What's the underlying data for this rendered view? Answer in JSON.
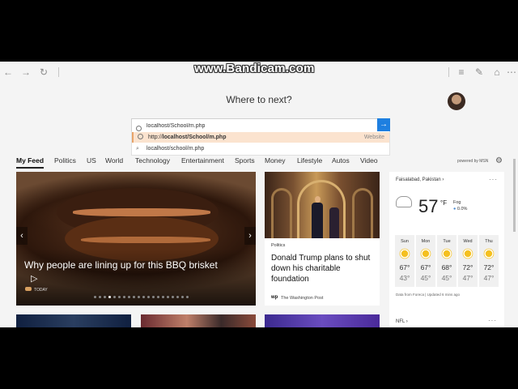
{
  "watermark": "www.Bandicam.com",
  "toolbar": {
    "back": "←",
    "forward": "→",
    "refresh": "↻"
  },
  "newtab": {
    "heading": "Where to next?"
  },
  "address": {
    "value": "localhost/School/m.php",
    "go": "→",
    "suggestions": [
      {
        "prefix": "http://",
        "bold": "localhost/School/m.php",
        "tag": "Website",
        "selected": true
      },
      {
        "text": "localhost/school/m.php",
        "selected": false
      }
    ]
  },
  "nav": {
    "items": [
      "My Feed",
      "Politics",
      "US",
      "World",
      "Technology",
      "Entertainment",
      "Sports",
      "Money",
      "Lifestyle",
      "Autos",
      "Video"
    ],
    "powered": "powered by MSN"
  },
  "hero": {
    "title": "Why people are lining up for this BBQ brisket",
    "badge": "TODAY"
  },
  "card2": {
    "tag": "Politics",
    "title": "Donald Trump plans to shut down his charitable foundation",
    "source": "The Washington Post",
    "logo": "wp"
  },
  "weather": {
    "location": "Faisalabad, Pakistan",
    "temp": "57",
    "unit": "°F",
    "condition": "Fog",
    "precip": "0.0%",
    "days": [
      {
        "name": "Sun",
        "hi": "67°",
        "lo": "43°",
        "icon": "sun-icon"
      },
      {
        "name": "Mon",
        "hi": "67°",
        "lo": "45°",
        "icon": "sun-icon"
      },
      {
        "name": "Tue",
        "hi": "68°",
        "lo": "45°",
        "icon": "sun-icon"
      },
      {
        "name": "Wed",
        "hi": "72°",
        "lo": "47°",
        "icon": "sun-icon"
      },
      {
        "name": "Thu",
        "hi": "72°",
        "lo": "47°",
        "icon": "partly-cloudy-icon"
      }
    ],
    "credit": "Data from Foreca | Updated 6 mins ago"
  },
  "nfl": {
    "label": "NFL"
  },
  "colors": {
    "accent": "#1e7fe0",
    "selection": "#fbe3cf"
  }
}
